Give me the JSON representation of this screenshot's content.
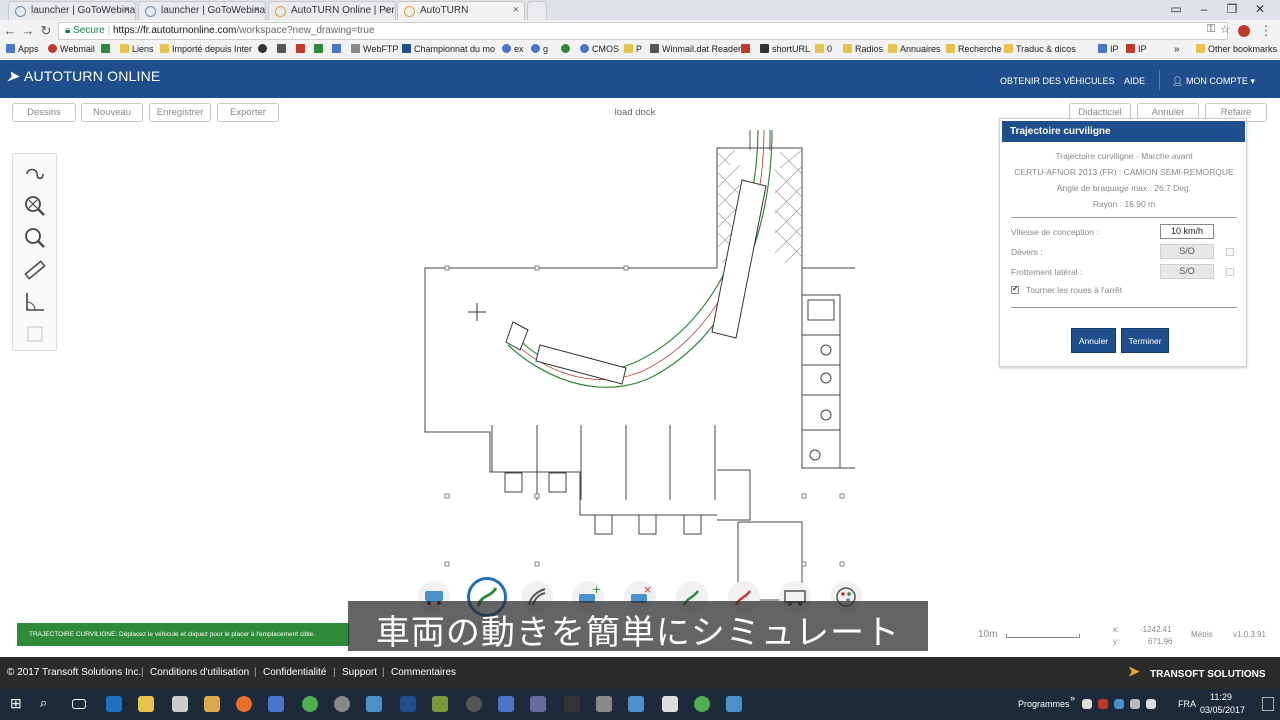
{
  "browser": {
    "tabs": [
      {
        "title": "launcher | GoToWebinar"
      },
      {
        "title": "launcher | GoToWebinar"
      },
      {
        "title": "AutoTURN Online | Perfo"
      },
      {
        "title": "AutoTURN"
      }
    ],
    "url_secure": "Secure",
    "url_domain": "https://fr.autoturnonline.com",
    "url_path": "/workspace?new_drawing=true",
    "bookmarks": [
      {
        "label": "Apps",
        "color": "#4a76c9"
      },
      {
        "label": "Webmail",
        "color": "#c0392b"
      },
      {
        "label": "",
        "color": "#2e8b3a"
      },
      {
        "label": "Liens",
        "color": "#e8c34a"
      },
      {
        "label": "Importé depuis Inter",
        "color": "#e8c34a"
      },
      {
        "label": "",
        "color": "#333333"
      },
      {
        "label": "S",
        "color": "#555555"
      },
      {
        "label": "",
        "color": "#c0392b"
      },
      {
        "label": "",
        "color": "#2e8b3a"
      },
      {
        "label": "",
        "color": "#4a76c9"
      },
      {
        "label": "",
        "color": "#4a76c9"
      },
      {
        "label": "WebFTP",
        "color": "#888888"
      },
      {
        "label": "Championnat du mo",
        "color": "#1e4f8c"
      },
      {
        "label": "ex",
        "color": "#4a76c9"
      },
      {
        "label": "g",
        "color": "#4a76c9"
      },
      {
        "label": "",
        "color": "#2e8b3a"
      },
      {
        "label": "CMOS",
        "color": "#4a76c9"
      },
      {
        "label": "P",
        "color": "#e8c34a"
      },
      {
        "label": "Winmail.dat Reader",
        "color": "#555555"
      },
      {
        "label": "",
        "color": "#c0392b"
      },
      {
        "label": "shortURL",
        "color": "#333333"
      },
      {
        "label": "0",
        "color": "#e8c34a"
      },
      {
        "label": "Radios",
        "color": "#e8c34a"
      },
      {
        "label": "Annuaires",
        "color": "#e8c34a"
      },
      {
        "label": "Recherche",
        "color": "#e8c34a"
      },
      {
        "label": "Traduc & dicos",
        "color": "#e8c34a"
      },
      {
        "label": "IP",
        "color": "#4a76c9"
      },
      {
        "label": "IP",
        "color": "#c0392b"
      },
      {
        "label": "Other bookmarks",
        "color": "#e8c34a"
      }
    ]
  },
  "app": {
    "logo": "AUTOTURN ONLINE",
    "nav_vehicles": "OBTENIR DES VÉHICULES",
    "nav_help": "AIDE",
    "nav_account": "MON COMPTE",
    "toolbar": {
      "dessins": "Dessins",
      "nouveau": "Nouveau",
      "enregistrer": "Enregistrer",
      "exporter": "Exporter",
      "didacticiel": "Didacticiel",
      "annuler": "Annuler",
      "refaire": "Refaire"
    },
    "document_name": "load dock"
  },
  "panel": {
    "title": "Trajectoire curviligne",
    "mode": "Trajectoire curviligne - Marche avant",
    "vehicle": "CERTU-AFNOR 2013 (FR) : CAMION SEMI-REMORQUE",
    "steering": "Angle de braquage max.: 26.7 Deg.",
    "radius": "Rayon : 16.90 m",
    "speed_label": "Vitesse de conception :",
    "speed_value": "10 km/h",
    "devers_label": "Dévers :",
    "devers_value": "S/O",
    "frottement_label": "Frottement latéral :",
    "frottement_value": "S/O",
    "turn_wheels": "Tourner les roues à l'arrêt",
    "turn_wheels_checked": true,
    "cancel": "Annuler",
    "finish": "Terminer"
  },
  "status": {
    "message": "TRAJECTOIRE CURVILIGNE: Déplacez le véhicule et cliquez pour le placer à l'emplacement cible.",
    "scale": "10m",
    "x_label": "x:",
    "x_value": "-1242.41",
    "y_label": "y:",
    "y_value": "671.96",
    "units": "Métris",
    "version": "v1.0.3.91"
  },
  "subtitle": "車両の動きを簡単にシミュレート",
  "footer": {
    "copyright": "© 2017 Transoft Solutions Inc.",
    "conditions": "Conditions d'utilisation",
    "privacy": "Confidentialité",
    "support": "Support",
    "comments": "Commentaires",
    "brand": "TRANSOFT SOLUTIONS"
  },
  "taskbar": {
    "programmes": "Programmes",
    "lang": "FRA",
    "time": "11:29",
    "date": "03/05/2017"
  }
}
